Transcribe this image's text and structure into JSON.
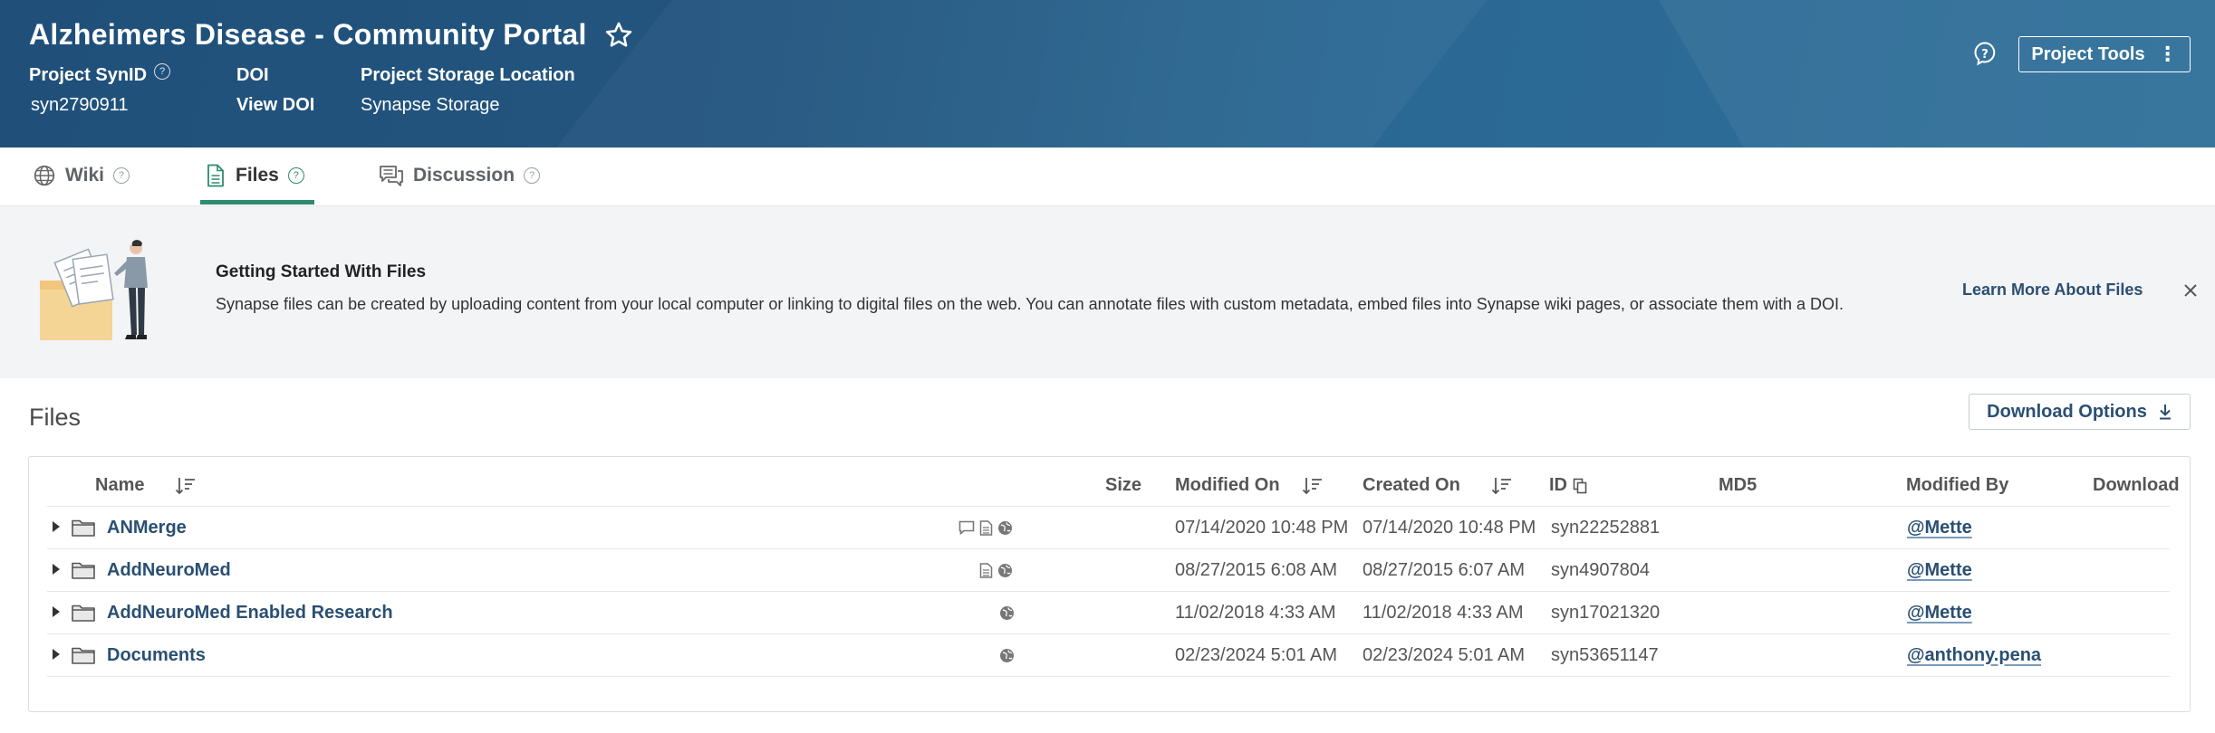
{
  "project": {
    "title": "Alzheimers Disease - Community Portal",
    "synid_label": "Project SynID",
    "synid_value": "syn2790911",
    "doi_label": "DOI",
    "doi_value": "View DOI",
    "storage_label": "Project Storage Location",
    "storage_value": "Synapse Storage",
    "tools_label": "Project Tools"
  },
  "tabs": [
    {
      "label": "Wiki",
      "icon": "globe-icon"
    },
    {
      "label": "Files",
      "icon": "file-icon",
      "active": true
    },
    {
      "label": "Discussion",
      "icon": "discussion-icon"
    }
  ],
  "banner": {
    "title": "Getting Started With Files",
    "text": "Synapse files can be created by uploading content from your local computer or linking to digital files on the web. You can annotate files with custom metadata, embed files into Synapse wiki pages, or associate them with a DOI.",
    "learn_more": "Learn More About Files"
  },
  "files": {
    "title": "Files",
    "download_options": "Download Options",
    "columns": {
      "name": "Name",
      "size": "Size",
      "modified_on": "Modified On",
      "created_on": "Created On",
      "id": "ID",
      "md5": "MD5",
      "modified_by": "Modified By",
      "download": "Download"
    },
    "rows": [
      {
        "name": "ANMerge",
        "modified_on": "07/14/2020 10:48 PM",
        "created_on": "07/14/2020 10:48 PM",
        "id": "syn22252881",
        "modified_by": "@Mette",
        "badges": [
          "discussion-icon",
          "wiki-icon",
          "public-icon"
        ]
      },
      {
        "name": "AddNeuroMed",
        "modified_on": "08/27/2015 6:08 AM",
        "created_on": "08/27/2015 6:07 AM",
        "id": "syn4907804",
        "modified_by": "@Mette",
        "badges": [
          "wiki-icon",
          "public-icon"
        ]
      },
      {
        "name": "AddNeuroMed Enabled Research",
        "modified_on": "11/02/2018 4:33 AM",
        "created_on": "11/02/2018 4:33 AM",
        "id": "syn17021320",
        "modified_by": "@Mette",
        "badges": [
          "public-icon"
        ]
      },
      {
        "name": "Documents",
        "modified_on": "02/23/2024 5:01 AM",
        "created_on": "02/23/2024 5:01 AM",
        "id": "syn53651147",
        "modified_by": "@anthony.pena",
        "badges": [
          "public-icon"
        ]
      }
    ]
  },
  "colors": {
    "header_bg": "#22557f",
    "link": "#2a4f72",
    "active_tab": "#2e8b6f",
    "banner_bg": "#f3f4f5"
  }
}
